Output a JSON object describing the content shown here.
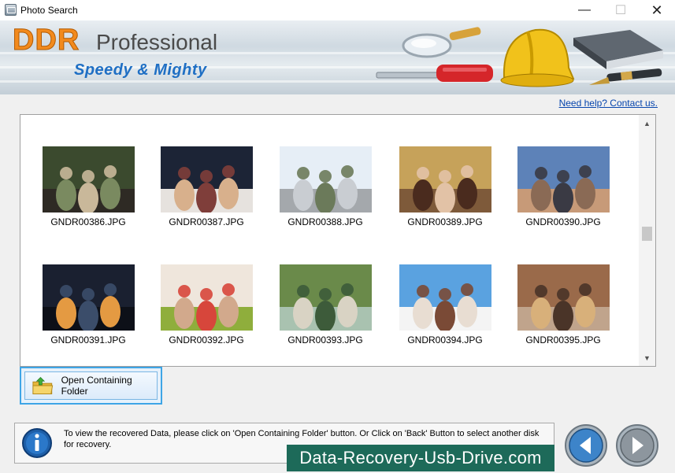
{
  "window": {
    "title": "Photo Search",
    "minimize": "—",
    "maximize": "☐",
    "close": "✕"
  },
  "banner": {
    "brand": "DDR",
    "product": "Professional",
    "slogan": "Speedy & Mighty"
  },
  "help": {
    "label": "Need help? Contact us."
  },
  "gallery": {
    "items": [
      {
        "filename": "GNDR00386.JPG",
        "colors": [
          "#3b4a2e",
          "#7a8a60",
          "#c9b89a",
          "#2e2a24"
        ]
      },
      {
        "filename": "GNDR00387.JPG",
        "colors": [
          "#1c2436",
          "#d8b08c",
          "#7f3e3a",
          "#e6e2de"
        ]
      },
      {
        "filename": "GNDR00388.JPG",
        "colors": [
          "#e6eef6",
          "#c9cdd2",
          "#6b7a5a",
          "#a4a8ac"
        ]
      },
      {
        "filename": "GNDR00389.JPG",
        "colors": [
          "#c6a25a",
          "#4a2b1e",
          "#e2c2a6",
          "#7e5a3a"
        ]
      },
      {
        "filename": "GNDR00390.JPG",
        "colors": [
          "#5d82b8",
          "#8a6a55",
          "#3a3a44",
          "#c79a78"
        ]
      },
      {
        "filename": "GNDR00391.JPG",
        "colors": [
          "#1a2030",
          "#e49a42",
          "#3b4d6a",
          "#0d1018"
        ]
      },
      {
        "filename": "GNDR00392.JPG",
        "colors": [
          "#efe6dc",
          "#d2a98c",
          "#d7463b",
          "#8fae3c"
        ]
      },
      {
        "filename": "GNDR00393.JPG",
        "colors": [
          "#6a8a4a",
          "#d9d3c4",
          "#3d5b3a",
          "#a9c2b0"
        ]
      },
      {
        "filename": "GNDR00394.JPG",
        "colors": [
          "#5aa2e0",
          "#e8ddd2",
          "#7a4a36",
          "#f4f4f4"
        ]
      },
      {
        "filename": "GNDR00395.JPG",
        "colors": [
          "#9a6a4a",
          "#d8b07a",
          "#4a3428",
          "#c0a48c"
        ]
      }
    ]
  },
  "actions": {
    "open_folder_label": "Open Containing Folder"
  },
  "status": {
    "info_text": "To view the recovered Data, please click on 'Open Containing Folder' button. Or Click on 'Back' Button to select another disk for recovery."
  },
  "watermark": {
    "text": "Data-Recovery-Usb-Drive.com"
  },
  "navigation": {
    "back_icon": "arrow-left-icon",
    "next_icon": "arrow-right-icon"
  },
  "colors": {
    "accent": "#3ea5e6",
    "brand_orange": "#f28a1d",
    "slogan_blue": "#1f6fc4",
    "watermark_bg": "#1d6a59"
  }
}
